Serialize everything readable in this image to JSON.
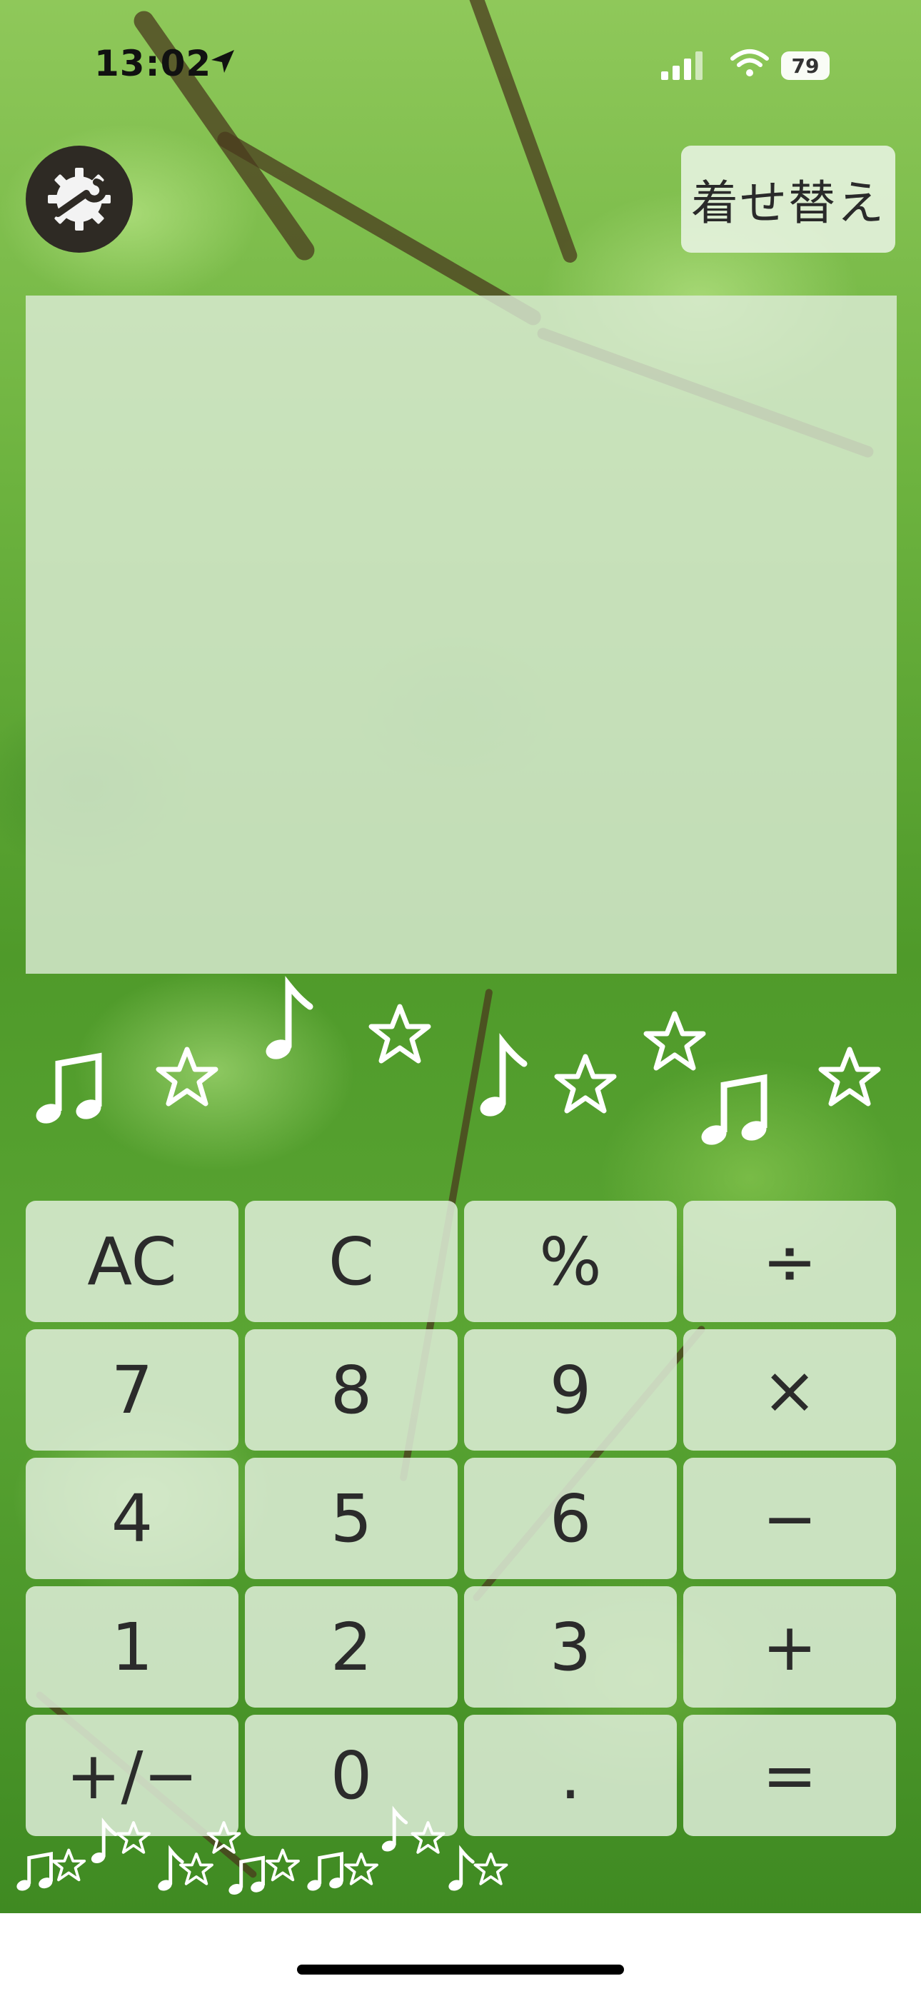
{
  "status_bar": {
    "time": "13:02",
    "battery": "79",
    "icons": [
      "location-arrow-icon",
      "signal-icon",
      "wifi-icon",
      "battery-icon"
    ]
  },
  "header": {
    "settings_icon": "gear-wrench-icon",
    "skin_button_label": "着せ替え"
  },
  "display": {
    "value": ""
  },
  "keypad": {
    "rows": [
      [
        "AC",
        "C",
        "%",
        "÷"
      ],
      [
        "7",
        "8",
        "9",
        "×"
      ],
      [
        "4",
        "5",
        "6",
        "−"
      ],
      [
        "1",
        "2",
        "3",
        "+"
      ],
      [
        "+/−",
        "0",
        ".",
        "="
      ]
    ]
  },
  "decorations": {
    "icons": [
      "music-note-icon",
      "star-icon"
    ]
  },
  "colors": {
    "key_bg": "#DEEDD8",
    "display_bg": "#DCECD6",
    "text": "#2B2B2B",
    "settings_bg": "#2E2A24"
  }
}
